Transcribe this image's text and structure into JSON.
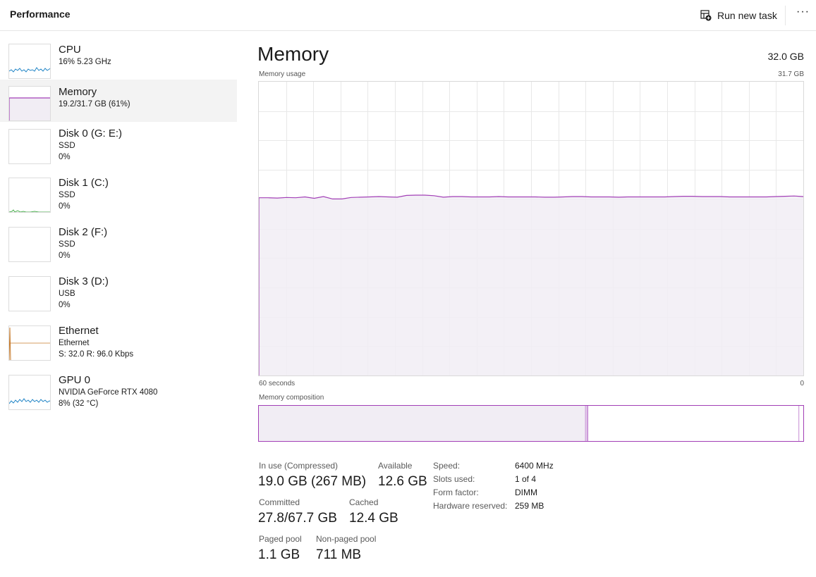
{
  "header": {
    "title": "Performance",
    "run_task_label": "Run new task",
    "more_label": "···"
  },
  "sidebar": {
    "items": [
      {
        "name": "CPU",
        "lines": [
          "16%  5.23 GHz"
        ],
        "selected": false
      },
      {
        "name": "Memory",
        "lines": [
          "19.2/31.7 GB (61%)"
        ],
        "selected": true
      },
      {
        "name": "Disk 0 (G: E:)",
        "lines": [
          "SSD",
          "0%"
        ],
        "selected": false
      },
      {
        "name": "Disk 1 (C:)",
        "lines": [
          "SSD",
          "0%"
        ],
        "selected": false
      },
      {
        "name": "Disk 2 (F:)",
        "lines": [
          "SSD",
          "0%"
        ],
        "selected": false
      },
      {
        "name": "Disk 3 (D:)",
        "lines": [
          "USB",
          "0%"
        ],
        "selected": false
      },
      {
        "name": "Ethernet",
        "lines": [
          "Ethernet",
          "S: 32.0  R: 96.0 Kbps"
        ],
        "selected": false
      },
      {
        "name": "GPU 0",
        "lines": [
          "NVIDIA GeForce RTX 4080",
          "8%  (32 °C)"
        ],
        "selected": false
      }
    ]
  },
  "main": {
    "title": "Memory",
    "total": "32.0 GB",
    "usage_label": "Memory usage",
    "usage_max": "31.7 GB",
    "time_left": "60 seconds",
    "time_right": "0",
    "composition_label": "Memory composition",
    "composition": {
      "in_use_fraction": 0.6,
      "modified_fraction": 0.004,
      "standby_fraction": 0.388
    }
  },
  "usage_series": [
    0.605,
    0.605,
    0.604,
    0.606,
    0.605,
    0.608,
    0.603,
    0.609,
    0.601,
    0.601,
    0.606,
    0.607,
    0.608,
    0.609,
    0.608,
    0.607,
    0.613,
    0.614,
    0.614,
    0.612,
    0.607,
    0.609,
    0.609,
    0.608,
    0.608,
    0.608,
    0.609,
    0.608,
    0.608,
    0.608,
    0.608,
    0.607,
    0.607,
    0.608,
    0.609,
    0.609,
    0.608,
    0.608,
    0.608,
    0.607,
    0.608,
    0.608,
    0.608,
    0.608,
    0.608,
    0.609,
    0.61,
    0.61,
    0.609,
    0.609,
    0.609,
    0.608,
    0.608,
    0.608,
    0.608,
    0.608,
    0.609,
    0.61,
    0.611,
    0.609
  ],
  "stats": {
    "in_use_label": "In use (Compressed)",
    "in_use_value": "19.0 GB (267 MB)",
    "available_label": "Available",
    "available_value": "12.6 GB",
    "committed_label": "Committed",
    "committed_value": "27.8/67.7 GB",
    "cached_label": "Cached",
    "cached_value": "12.4 GB",
    "paged_label": "Paged pool",
    "paged_value": "1.1 GB",
    "nonpaged_label": "Non-paged pool",
    "nonpaged_value": "711 MB"
  },
  "details": [
    {
      "label": "Speed:",
      "value": "6400 MHz"
    },
    {
      "label": "Slots used:",
      "value": "1 of 4"
    },
    {
      "label": "Form factor:",
      "value": "DIMM"
    },
    {
      "label": "Hardware reserved:",
      "value": "259 MB"
    }
  ],
  "colors": {
    "memory_line": "#a23fb6",
    "memory_fill": "#f1edf4",
    "cpu_line": "#1f84c6",
    "disk_line": "#4caf50",
    "ethernet_line": "#c77b2c",
    "grid": "#e8e8e8"
  },
  "icons": {
    "run_task": "task-add-icon",
    "more": "more-icon"
  }
}
